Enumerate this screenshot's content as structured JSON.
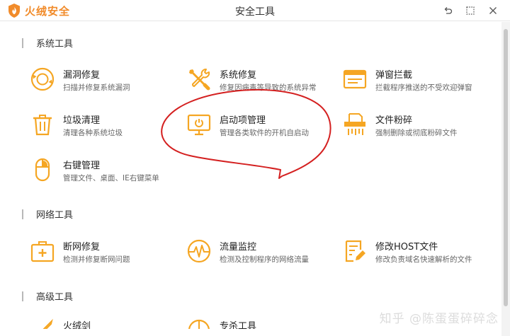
{
  "app": {
    "name": "火绒安全",
    "window_title": "安全工具",
    "brand_color": "#f18b2a",
    "icon_color": "#f5a623"
  },
  "window_controls": [
    "back-icon",
    "restore-icon",
    "close-icon"
  ],
  "sections": [
    {
      "title": "系统工具",
      "tools": [
        {
          "name": "漏洞修复",
          "desc": "扫描并修复系统漏洞",
          "icon": "vulnerability-repair-icon"
        },
        {
          "name": "系统修复",
          "desc": "修复因病毒等导致的系统异常",
          "icon": "wrench-screwdriver-icon"
        },
        {
          "name": "弹窗拦截",
          "desc": "拦截程序推送的不受欢迎弹窗",
          "icon": "popup-window-icon"
        },
        {
          "name": "垃圾清理",
          "desc": "清理各种系统垃圾",
          "icon": "trash-can-icon"
        },
        {
          "name": "启动项管理",
          "desc": "管理各类软件的开机自启动",
          "icon": "monitor-power-icon"
        },
        {
          "name": "文件粉碎",
          "desc": "强制删除或彻底粉碎文件",
          "icon": "file-shredder-icon"
        },
        {
          "name": "右键管理",
          "desc": "管理文件、桌面、IE右键菜单",
          "icon": "mouse-icon"
        }
      ]
    },
    {
      "title": "网络工具",
      "tools": [
        {
          "name": "断网修复",
          "desc": "检测并修复断网问题",
          "icon": "medical-kit-icon"
        },
        {
          "name": "流量监控",
          "desc": "检测及控制程序的网络流量",
          "icon": "pulse-gauge-icon"
        },
        {
          "name": "修改HOST文件",
          "desc": "修改负责域名快速解析的文件",
          "icon": "edit-document-icon"
        }
      ]
    },
    {
      "title": "高级工具",
      "tools": [
        {
          "name": "火绒剑",
          "icon": "sword-icon"
        },
        {
          "name": "专杀工具",
          "icon": "kill-tool-icon"
        }
      ]
    }
  ],
  "watermark": "知乎 @陈蛋蛋碎碎念"
}
